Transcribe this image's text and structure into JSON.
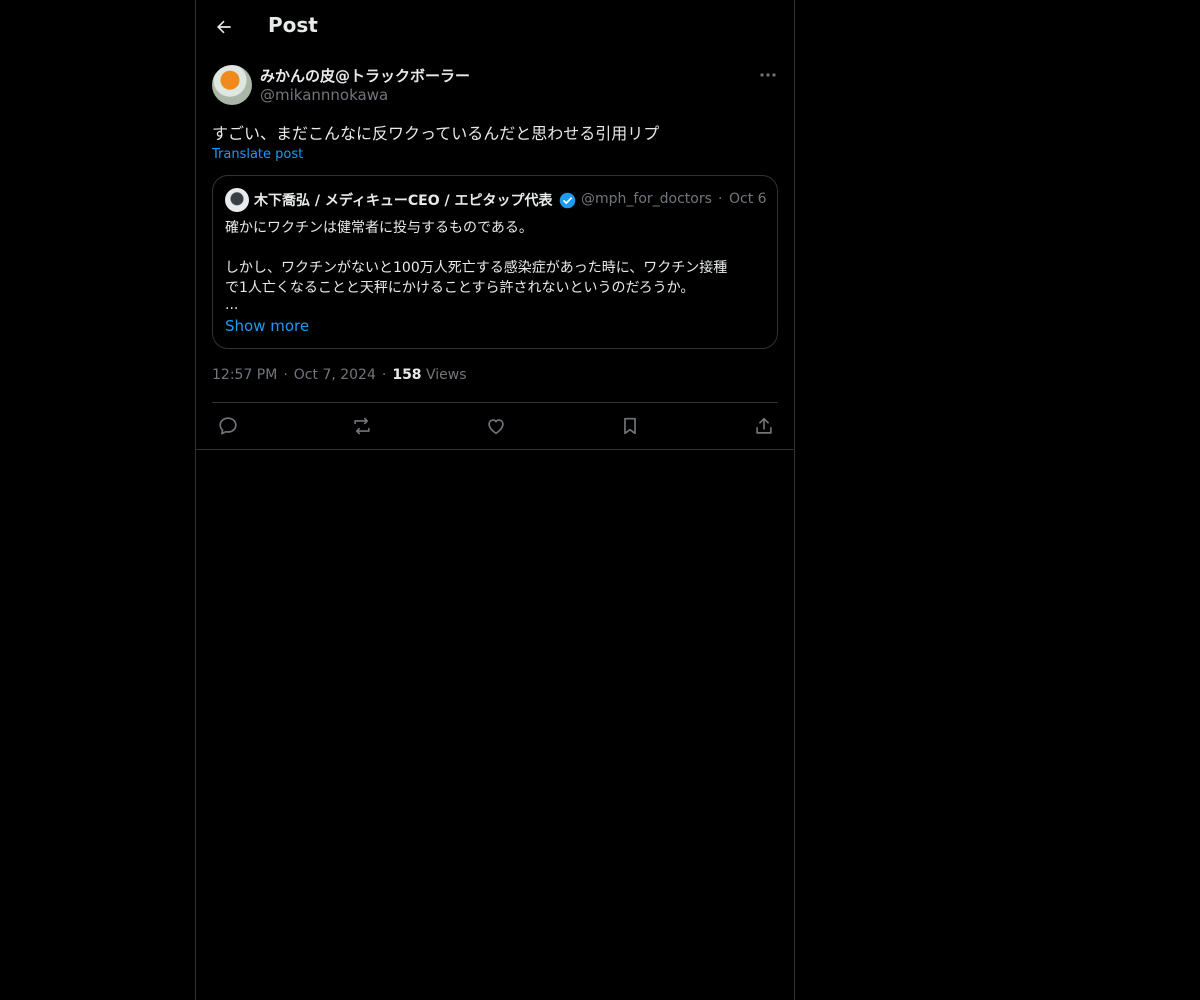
{
  "header": {
    "title": "Post"
  },
  "post": {
    "author_name": "みかんの皮@トラックボーラー",
    "author_handle": "@mikannnokawa",
    "text": "すごい、まだこんなに反ワクっているんだと思わせる引用リプ",
    "translate_label": "Translate post",
    "time": "12:57 PM",
    "date": "Oct 7, 2024",
    "views_count": "158",
    "views_label": "Views"
  },
  "quote": {
    "author_name": "木下喬弘 / メディキューCEO / エピタップ代表",
    "handle": "@mph_for_doctors",
    "dot": "·",
    "date": "Oct 6",
    "lines": [
      "確かにワクチンは健常者に投与するものである。",
      "しかし、ワクチンがないと100万人死亡する感染症があった時に、ワクチン接種",
      "で1人亡くなることと天秤にかけることすら許されないというのだろうか。",
      "..."
    ],
    "show_more": "Show more"
  },
  "separator": "·",
  "icons": {
    "back": "arrow-left-icon",
    "more": "more-horizontal-icon",
    "verified": "verified-badge-icon",
    "reply": "reply-icon",
    "repost": "repost-icon",
    "like": "heart-icon",
    "bookmark": "bookmark-icon",
    "share": "share-icon"
  },
  "colors": {
    "background": "#000000",
    "text": "#e7e9ea",
    "secondary": "#71767b",
    "accent": "#1d9bf0",
    "border": "#2f3336"
  }
}
